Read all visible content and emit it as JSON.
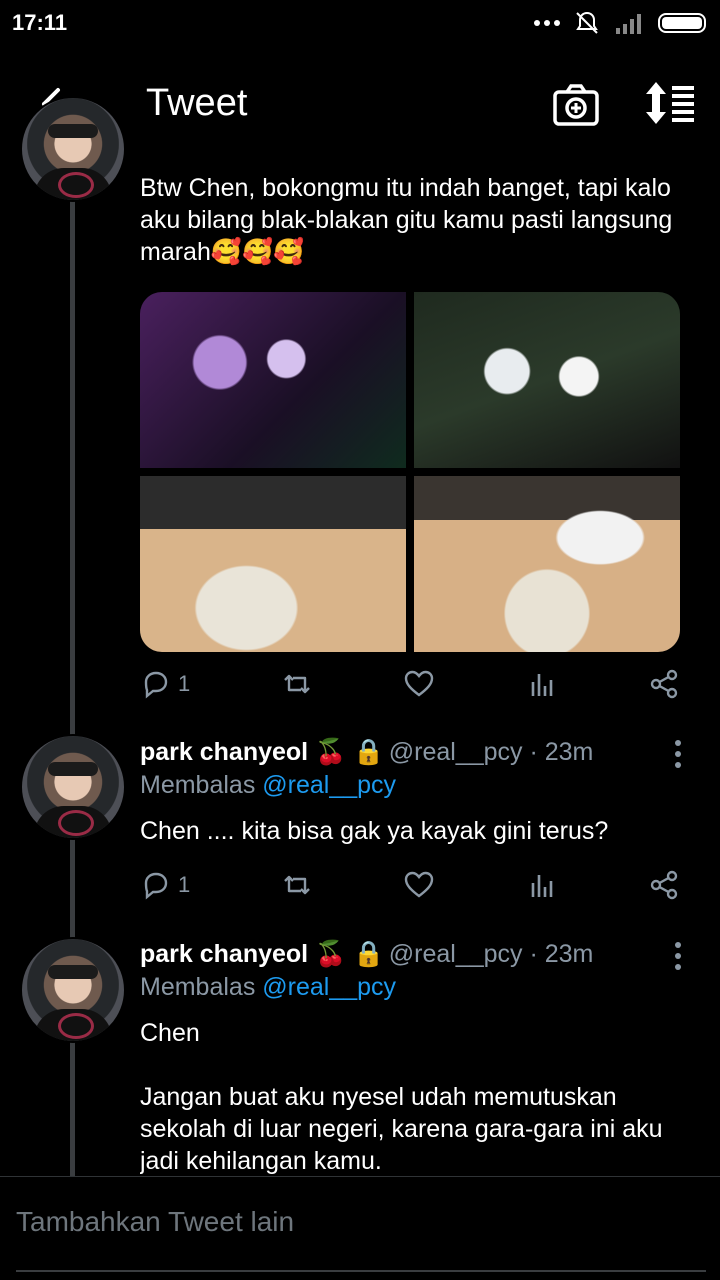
{
  "status_bar": {
    "time": "17:11"
  },
  "header": {
    "title": "Tweet",
    "back_icon": "arrow-left-icon",
    "camera_icon": "camera-plus-icon",
    "sort_icon": "sort-icon"
  },
  "main_tweet": {
    "text": "Btw Chen, bokongmu itu indah banget, tapi kalo aku bilang blak-blakan gitu kamu pasti langsung marah🥰🥰🥰",
    "reply_count": "1",
    "media_count": 4
  },
  "replies": [
    {
      "name": "park chanyeol 🍒 🔒",
      "handle": "@real__pcy · 23m",
      "reply_prefix": "Membalas",
      "reply_to": "@real__pcy",
      "text": "Chen .... kita bisa gak ya kayak gini terus?",
      "reply_count": "1"
    },
    {
      "name": "park chanyeol 🍒 🔒",
      "handle": "@real__pcy · 23m",
      "reply_prefix": "Membalas",
      "reply_to": "@real__pcy",
      "text_line1": "Chen",
      "text_line2": "Jangan buat aku nyesel udah memutuskan sekolah di luar negeri, karena gara-gara ini aku jadi kehilangan kamu."
    }
  ],
  "compose": {
    "placeholder": "Tambahkan Tweet lain"
  },
  "colors": {
    "background": "#000000",
    "secondary_text": "#8b98a5",
    "link": "#1d9bf0"
  }
}
